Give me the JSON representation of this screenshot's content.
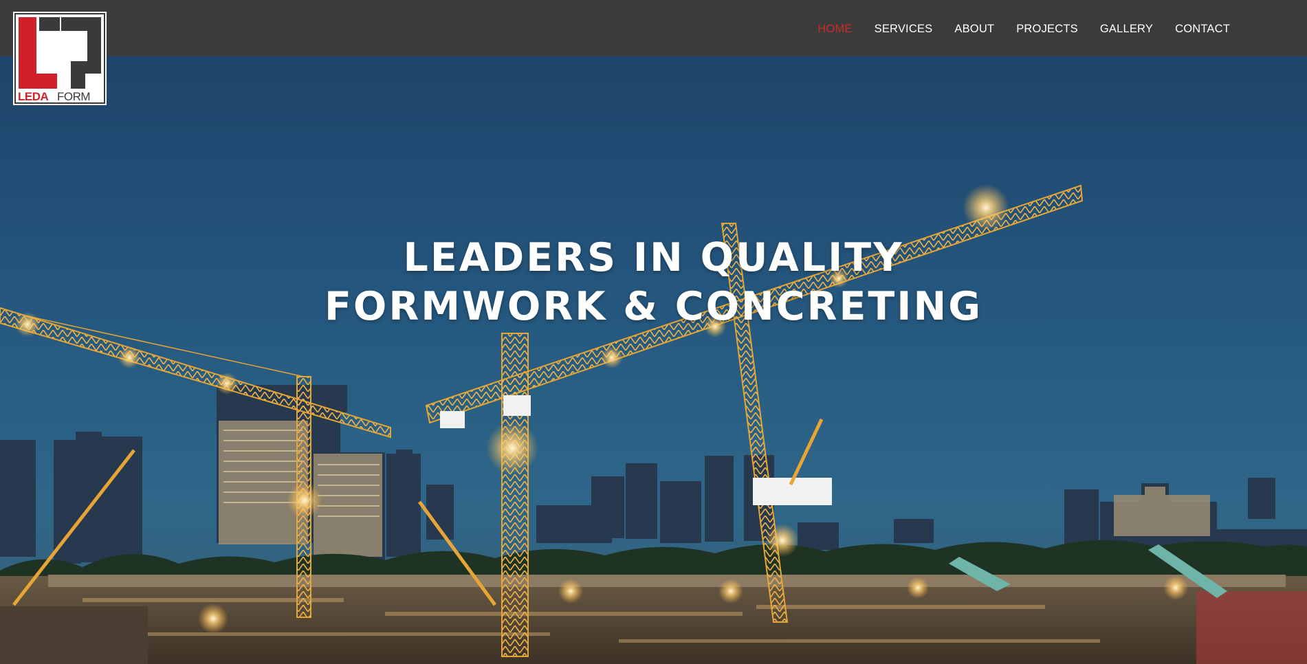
{
  "brand": {
    "logo_text_left": "LEDA",
    "logo_text_right": "FORM",
    "logo_colors": {
      "red": "#d0202a",
      "dark": "#3a3a3a",
      "white": "#ffffff"
    }
  },
  "nav": {
    "items": [
      {
        "label": "HOME",
        "active": true
      },
      {
        "label": "SERVICES",
        "active": false
      },
      {
        "label": "ABOUT",
        "active": false
      },
      {
        "label": "PROJECTS",
        "active": false
      },
      {
        "label": "GALLERY",
        "active": false
      },
      {
        "label": "CONTACT",
        "active": false
      }
    ],
    "active_color": "#cc2a2a"
  },
  "hero": {
    "headline_line1": "LEADERS IN QUALITY",
    "headline_line2": "FORMWORK & CONCRETING",
    "background": "night construction site with tower cranes and city skyline"
  },
  "colors": {
    "topbar": "#3b3b3b",
    "sky_top": "#1f4a78",
    "sky_bottom": "#2b6590",
    "crane": "#e7a634"
  }
}
